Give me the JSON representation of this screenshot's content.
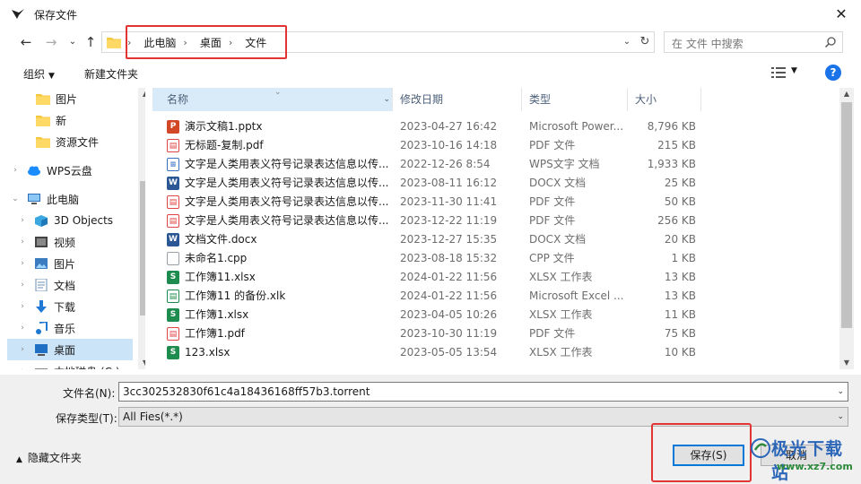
{
  "window": {
    "title": "保存文件",
    "close": "✕"
  },
  "address": {
    "crumbs": [
      "此电脑",
      "桌面",
      "文件"
    ],
    "search_placeholder": "在 文件 中搜索"
  },
  "toolbar": {
    "organize": "组织",
    "new_folder": "新建文件夹",
    "help": "?"
  },
  "nav": {
    "items": [
      {
        "label": "图片",
        "icon": "folder-icon"
      },
      {
        "label": "新",
        "icon": "folder-icon"
      },
      {
        "label": "资源文件",
        "icon": "folder-icon"
      },
      {
        "label": "WPS云盘",
        "icon": "cloud-icon"
      },
      {
        "label": "此电脑",
        "icon": "computer-icon"
      },
      {
        "label": "3D Objects",
        "icon": "cube-icon"
      },
      {
        "label": "视频",
        "icon": "video-icon"
      },
      {
        "label": "图片",
        "icon": "picture-icon"
      },
      {
        "label": "文档",
        "icon": "document-icon"
      },
      {
        "label": "下载",
        "icon": "download-icon"
      },
      {
        "label": "音乐",
        "icon": "music-icon"
      },
      {
        "label": "桌面",
        "icon": "desktop-icon",
        "selected": true
      },
      {
        "label": "本地磁盘 (C:)",
        "icon": "drive-icon"
      }
    ]
  },
  "columns": {
    "name": "名称",
    "date": "修改日期",
    "type": "类型",
    "size": "大小"
  },
  "files": [
    {
      "name": "演示文稿1.pptx",
      "date": "2023-04-27 16:42",
      "type": "Microsoft Power...",
      "size": "8,796 KB",
      "kind": "pptx",
      "color": "#d24726"
    },
    {
      "name": "无标题-复制.pdf",
      "date": "2023-10-16 14:18",
      "type": "PDF 文件",
      "size": "215 KB",
      "kind": "pdf",
      "color": "#e04444"
    },
    {
      "name": "文字是人类用表义符号记录表达信息以传...",
      "date": "2022-12-26 8:54",
      "type": "WPS文字 文档",
      "size": "1,933 KB",
      "kind": "wps",
      "color": "#3a6fc4"
    },
    {
      "name": "文字是人类用表义符号记录表达信息以传...",
      "date": "2023-08-11 16:12",
      "type": "DOCX 文档",
      "size": "25 KB",
      "kind": "docx",
      "color": "#2b5797"
    },
    {
      "name": "文字是人类用表义符号记录表达信息以传...",
      "date": "2023-11-30 11:41",
      "type": "PDF 文件",
      "size": "50 KB",
      "kind": "pdf",
      "color": "#e04444"
    },
    {
      "name": "文字是人类用表义符号记录表达信息以传...",
      "date": "2023-12-22 11:19",
      "type": "PDF 文件",
      "size": "256 KB",
      "kind": "pdf",
      "color": "#e04444"
    },
    {
      "name": "文档文件.docx",
      "date": "2023-12-27 15:35",
      "type": "DOCX 文档",
      "size": "20 KB",
      "kind": "docx",
      "color": "#2b5797"
    },
    {
      "name": "未命名1.cpp",
      "date": "2023-08-18 15:32",
      "type": "CPP 文件",
      "size": "1 KB",
      "kind": "generic",
      "color": "#9aa0a6"
    },
    {
      "name": "工作簿11.xlsx",
      "date": "2024-01-22 11:56",
      "type": "XLSX 工作表",
      "size": "13 KB",
      "kind": "xlsx",
      "color": "#1e8c4e"
    },
    {
      "name": "工作簿11 的备份.xlk",
      "date": "2024-01-22 11:56",
      "type": "Microsoft Excel ...",
      "size": "13 KB",
      "kind": "xlk",
      "color": "#1e8c4e"
    },
    {
      "name": "工作簿1.xlsx",
      "date": "2023-04-05 10:26",
      "type": "XLSX 工作表",
      "size": "11 KB",
      "kind": "xlsx",
      "color": "#1e8c4e"
    },
    {
      "name": "工作簿1.pdf",
      "date": "2023-10-30 11:19",
      "type": "PDF 文件",
      "size": "75 KB",
      "kind": "pdf",
      "color": "#e04444"
    },
    {
      "name": "123.xlsx",
      "date": "2023-05-05 13:54",
      "type": "XLSX 工作表",
      "size": "10 KB",
      "kind": "xlsx",
      "color": "#1e8c4e"
    }
  ],
  "form": {
    "filename_label": "文件名(N):",
    "filename_value": "3cc302532830f61c4a18436168ff57b3.torrent",
    "filetype_label": "保存类型(T):",
    "filetype_value": "All Fies(*.*)"
  },
  "footer": {
    "hide_folders": "隐藏文件夹",
    "save": "保存(S)",
    "cancel": "取消"
  },
  "watermark": {
    "title": "极光下载站",
    "url": "www.xz7.com"
  }
}
